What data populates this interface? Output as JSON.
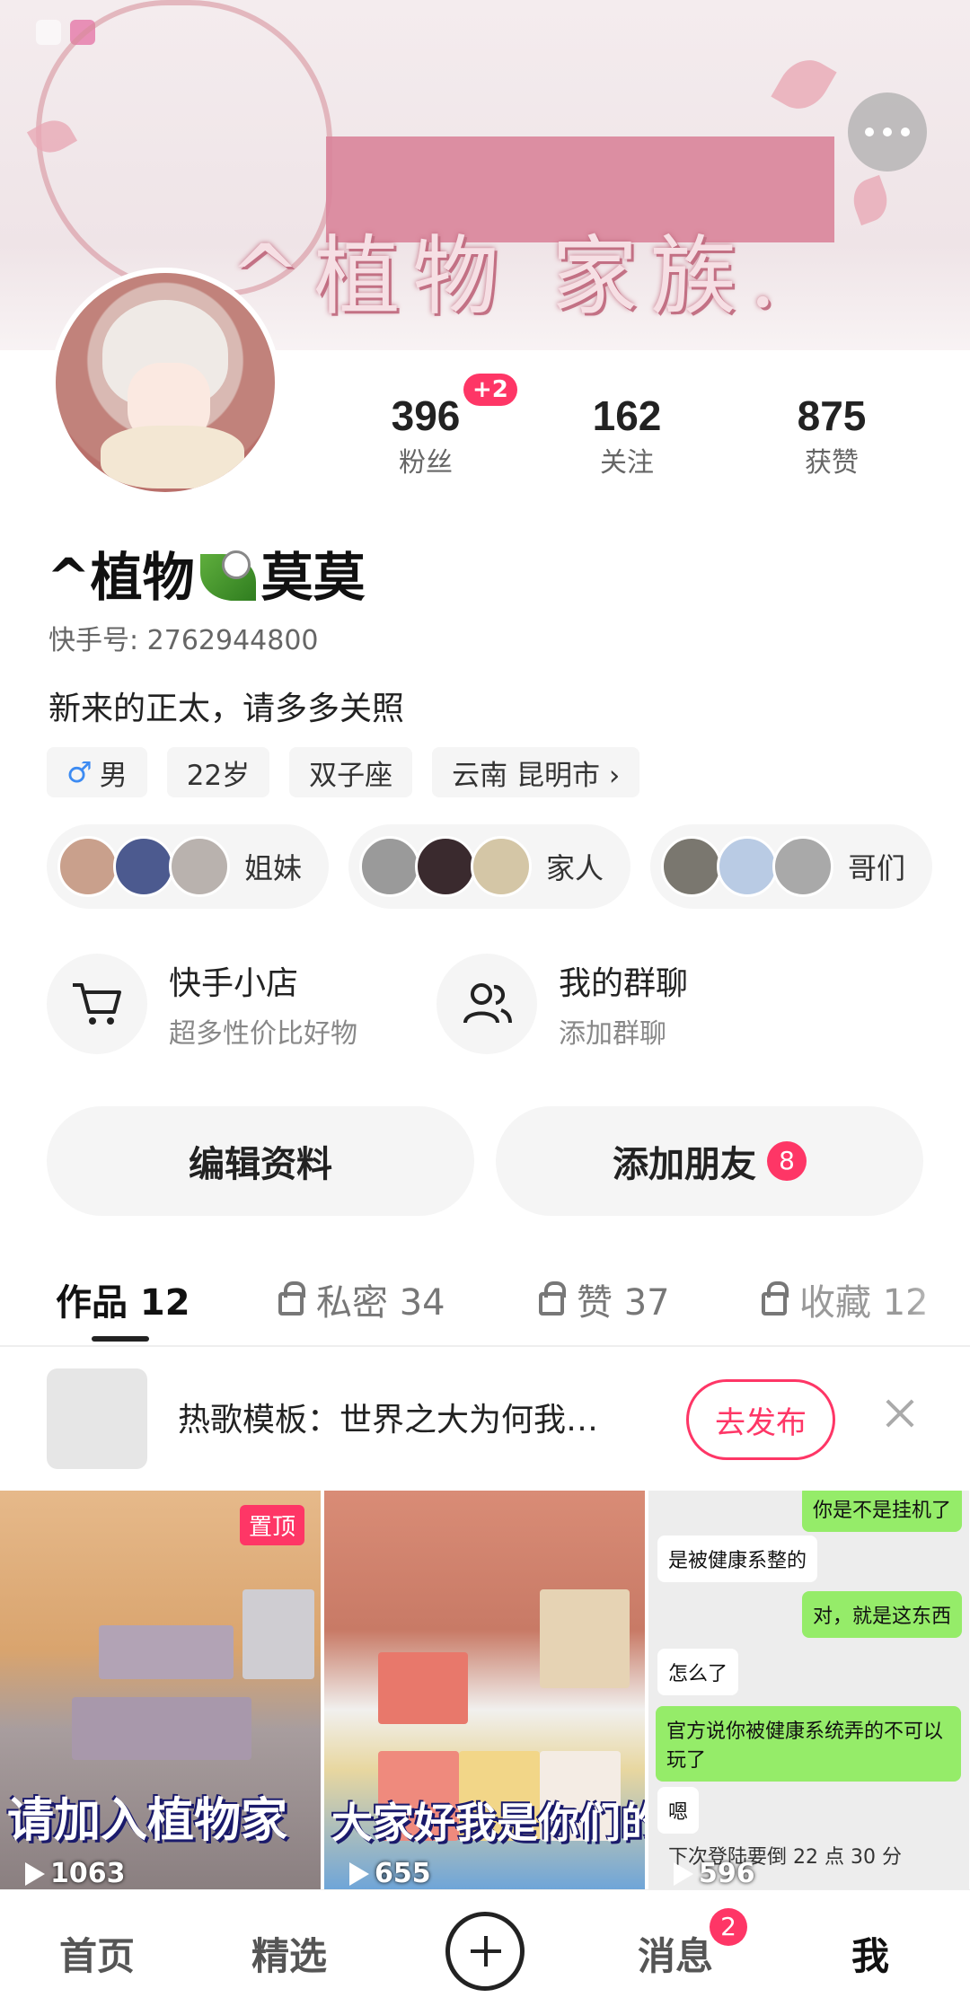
{
  "banner": {
    "title": "^植物 家族."
  },
  "profile": {
    "name_part1": "^植物",
    "name_part2": "莫莫",
    "kuaishou_id": "快手号: 2762944800",
    "bio": "新来的正太，请多多关照"
  },
  "stats": {
    "fans": {
      "value": "396",
      "label": "粉丝",
      "badge": "+2"
    },
    "following": {
      "value": "162",
      "label": "关注"
    },
    "likes": {
      "value": "875",
      "label": "获赞"
    }
  },
  "tags": {
    "gender": "男",
    "age": "22岁",
    "zodiac": "双子座",
    "location": "云南 昆明市 ›"
  },
  "circles": [
    {
      "label": "姐妹"
    },
    {
      "label": "家人"
    },
    {
      "label": "哥们"
    }
  ],
  "services": {
    "shop": {
      "title": "快手小店",
      "subtitle": "超多性价比好物"
    },
    "group_chat": {
      "title": "我的群聊",
      "subtitle": "添加群聊"
    }
  },
  "actions": {
    "edit_profile": "编辑资料",
    "add_friend": "添加朋友",
    "add_friend_badge": "8"
  },
  "tabs": {
    "works": "作品 12",
    "private": "私密 34",
    "liked": "赞 37",
    "favorites": "收藏 12"
  },
  "hot_song": {
    "text": "热歌模板：世界之大为何我…",
    "publish_label": "去发布"
  },
  "videos": [
    {
      "plays": "1063",
      "pinned": "置顶",
      "overlay": "请加入植物家"
    },
    {
      "plays": "655",
      "overlay": "大家好我是你们的"
    },
    {
      "plays": "596",
      "chat": [
        "你是不是挂机了",
        "是被健康系整的",
        "对，就是这东西",
        "怎么了",
        "官方说你被健康系统弄的不可以玩了",
        "嗯",
        "下次登陆要倒 22 点 30 分"
      ]
    }
  ],
  "bottom_nav": {
    "home": "首页",
    "featured": "精选",
    "messages": "消息",
    "messages_badge": "2",
    "me": "我"
  },
  "colors": {
    "accent": "#fe3666",
    "banner_pink": "#d9849a"
  }
}
